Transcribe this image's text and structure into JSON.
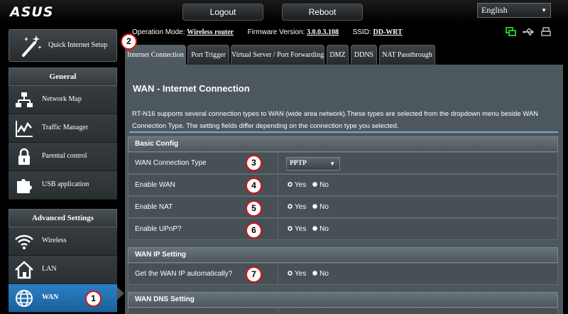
{
  "brand": "ASUS",
  "topbar": {
    "logout": "Logout",
    "reboot": "Reboot",
    "language": "English"
  },
  "status": {
    "op_mode_label": "Operation Mode:",
    "op_mode_value": "Wireless router",
    "firmware_label": "Firmware Version:",
    "firmware_value": "3.0.0.3.108",
    "ssid_label": "SSID:",
    "ssid_value": "DD-WRT"
  },
  "sidebar": {
    "quick_setup": "Quick Internet Setup",
    "general_title": "General",
    "general_items": [
      "Network Map",
      "Traffic Manager",
      "Parental control",
      "USB application"
    ],
    "advanced_title": "Advanced Settings",
    "advanced_items": [
      "Wireless",
      "LAN",
      "WAN"
    ]
  },
  "tabs": [
    "Internet Connection",
    "Port Trigger",
    "Virtual Server / Port Forwarding",
    "DMZ",
    "DDNS",
    "NAT Passthrough"
  ],
  "page": {
    "title": "WAN - Internet Connection",
    "description": "RT-N16 supports several connection types to WAN (wide area network).These types are selected from the dropdown menu beside WAN Connection Type. The setting fields differ depending on the connection type you selected."
  },
  "basic_config": {
    "title": "Basic Config",
    "wan_type_label": "WAN Connection Type",
    "wan_type_value": "PPTP",
    "enable_wan": "Enable WAN",
    "enable_nat": "Enable NAT",
    "enable_upnp": "Enable UPnP?"
  },
  "wan_ip": {
    "title": "WAN IP Setting",
    "auto_label": "Get the WAN IP automatically?"
  },
  "wan_dns": {
    "title": "WAN DNS Setting"
  },
  "radio": {
    "yes": "Yes",
    "no": "No"
  },
  "callouts": [
    "1",
    "2",
    "3",
    "4",
    "5",
    "6",
    "7"
  ],
  "colors": {
    "accent": "#2b80c5",
    "panel": "#4d585e",
    "callout_border": "#dd1111",
    "icon_green": "#27c02a"
  }
}
